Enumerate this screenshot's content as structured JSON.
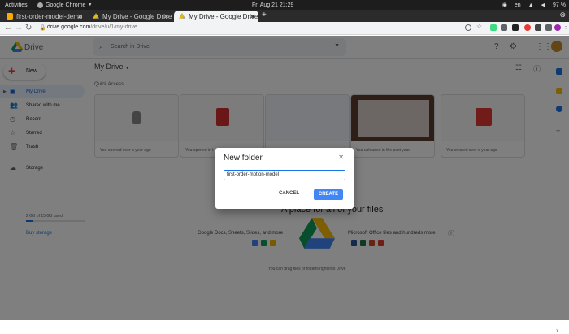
{
  "system_bar": {
    "activities": "Activities",
    "app_name": "Google Chrome",
    "clock": "Fri Aug 21  21:29",
    "lang": "en",
    "battery": "97 %"
  },
  "browser": {
    "tabs": [
      {
        "label": "first-order-model-demo"
      },
      {
        "label": "My Drive - Google Drive"
      },
      {
        "label": "My Drive - Google Drive"
      }
    ],
    "url_host": "drive.google.com",
    "url_path": "/drive/u/1/my-drive"
  },
  "drive": {
    "brand": "Drive",
    "search_placeholder": "Search in Drive",
    "new_label": "New",
    "sidebar": [
      {
        "label": "My Drive"
      },
      {
        "label": "Shared with me"
      },
      {
        "label": "Recent"
      },
      {
        "label": "Starred"
      },
      {
        "label": "Trash"
      },
      {
        "label": "Storage"
      }
    ],
    "storage_text": "2 GB of 15 GB used",
    "storage_fraction": 0.13,
    "buy_storage": "Buy storage",
    "page_title": "My Drive",
    "quick_access": "Quick Access",
    "cards": [
      {
        "caption": "You opened over a year ago"
      },
      {
        "caption": "You opened in t"
      },
      {
        "caption": ""
      },
      {
        "caption": "You uploaded in the past year"
      },
      {
        "caption": "You created over a year ago"
      }
    ],
    "empty_title": "A place for all of your files",
    "google_docs": "Google Docs, Sheets, Slides, and more",
    "ms_office": "Microsoft Office files and hundreds more",
    "drag_text": "You can drag files or folders right into Drive"
  },
  "dialog": {
    "title": "New folder",
    "input_value": "first-order-motion-model",
    "cancel": "CANCEL",
    "create": "CREATE"
  }
}
